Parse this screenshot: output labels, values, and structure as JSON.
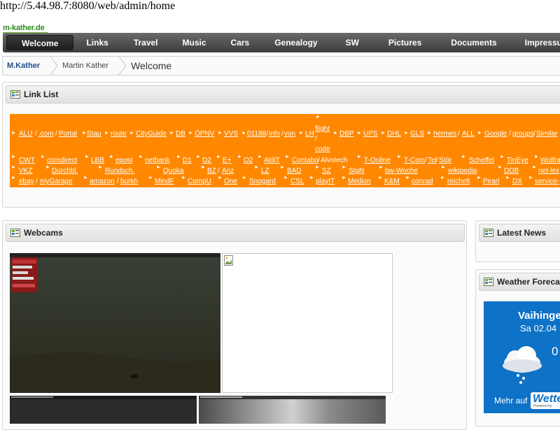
{
  "url": "http://5.44.98.7:8080/web/admin/home",
  "logo": "m-kather.de",
  "nav": {
    "items": [
      "Welcome",
      "Links",
      "Travel",
      "Music",
      "Cars",
      "Genealogy",
      "SW",
      "Pictures",
      "Documents",
      "Impressum"
    ],
    "active": "Welcome"
  },
  "breadcrumb": [
    "M.Kather",
    "Martin Kather",
    "Welcome"
  ],
  "link_list": {
    "title": "Link List",
    "row1": [
      "ALU",
      ".com",
      "Portal",
      "Stau",
      "route",
      "CityGuide",
      "DB",
      "ÖPNV",
      "VVS",
      "01188",
      "info",
      "von",
      "LH",
      "flight",
      "code",
      "DBP",
      "UPS",
      "DHL",
      "GLS",
      "hermes",
      "ALL",
      "Google",
      "groups",
      "Similar"
    ],
    "row2": [
      "CWT",
      "comdirect",
      "LBB",
      "epost",
      "netbank",
      "D1",
      "D2",
      "E+",
      "O2",
      "AldiT",
      "Contabo",
      "Alvotech",
      "T-Online",
      "T-Com",
      "Tel",
      "Stör",
      "Scheffel",
      "TinEye",
      "Wolfra"
    ],
    "row3": [
      "VKZ",
      "Durchbl.",
      "Rundsch.",
      "Quoka",
      "BZ",
      "Anz",
      "LZ",
      "BAD",
      "SZ",
      "StgN",
      "bw-Woche",
      "wikipedia",
      "DDB",
      "net-lex"
    ],
    "row4": [
      "ebay",
      "myGarage",
      "amazon",
      "burkh",
      "MindF",
      "CompU",
      "One",
      "Snogard",
      "CSL",
      "playIT",
      "Medion",
      "K&M",
      "conrad",
      "reichelt",
      "Pearl",
      "DX",
      "service-"
    ]
  },
  "webcams": {
    "title": "Webcams"
  },
  "latest_news": {
    "title": "Latest News"
  },
  "weather": {
    "title": "Weather Forecas",
    "location": "Vaihinge",
    "date": "Sa 02.04",
    "temp": "0",
    "more_label": "Mehr auf",
    "brand": "Wette",
    "powered": "Powered by"
  },
  "colors": {
    "nav_bg": "#4a4a4a",
    "link_list_bg": "#ff8800",
    "weather_bg": "#0e72c6",
    "logo": "#2e8b1e"
  }
}
